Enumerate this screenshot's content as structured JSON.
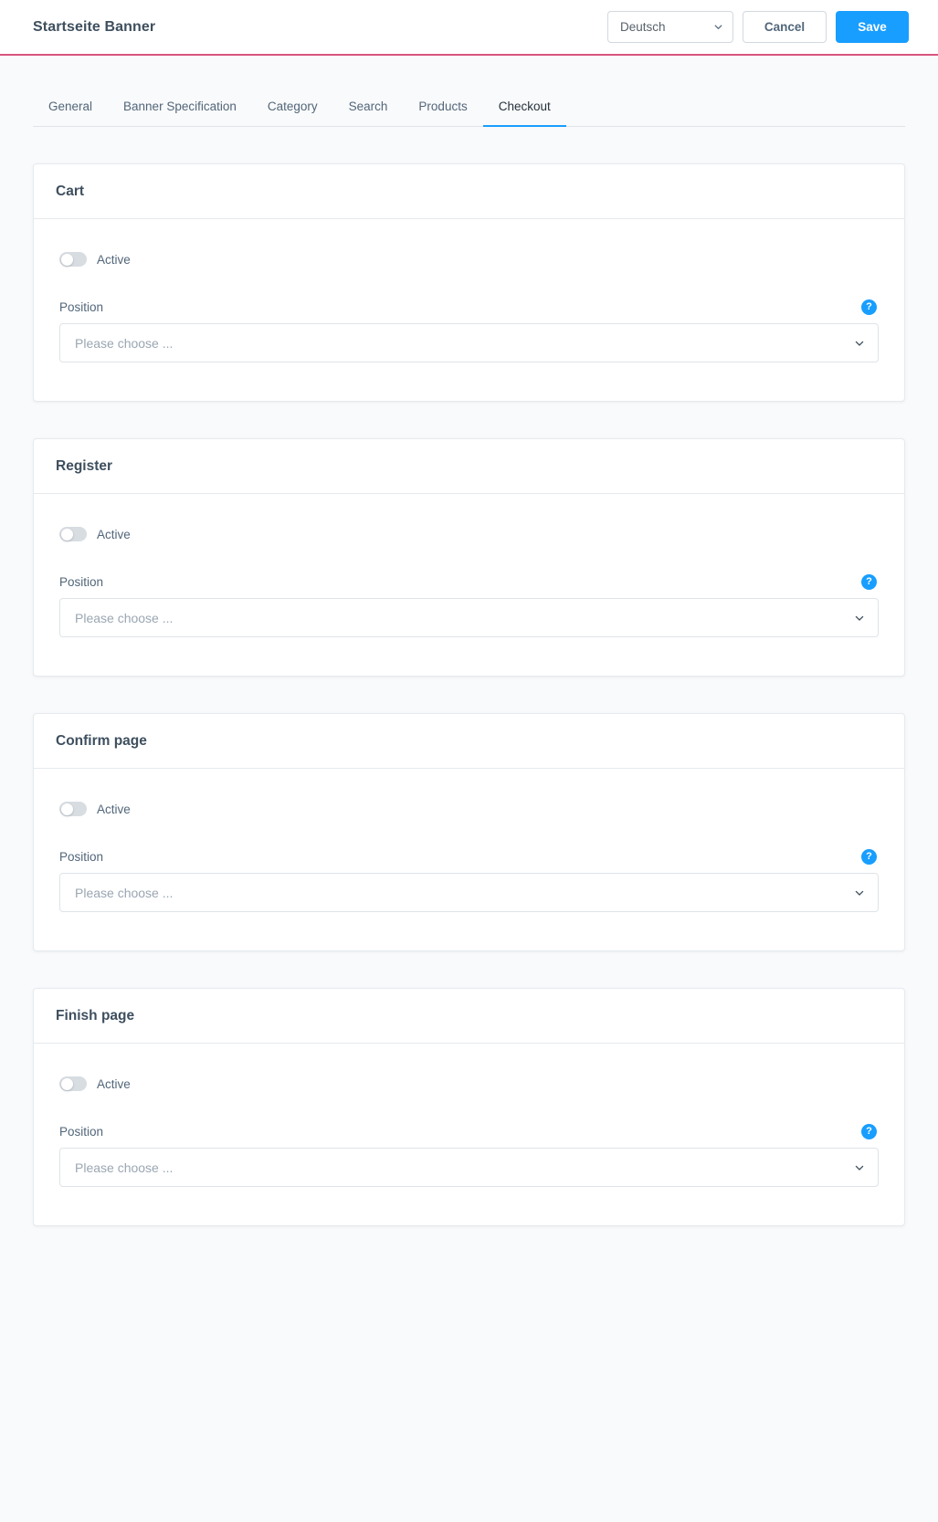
{
  "header": {
    "title": "Startseite Banner",
    "language_select": {
      "value": "Deutsch",
      "chevron": "chevron-down-icon"
    },
    "cancel_label": "Cancel",
    "save_label": "Save",
    "accent_bottom_border": "#d8547f",
    "primary_color": "#189eff"
  },
  "tabs": [
    {
      "label": "General",
      "active": false
    },
    {
      "label": "Banner Specification",
      "active": false
    },
    {
      "label": "Category",
      "active": false
    },
    {
      "label": "Search",
      "active": false
    },
    {
      "label": "Products",
      "active": false
    },
    {
      "label": "Checkout",
      "active": true
    }
  ],
  "common": {
    "switch_label": "Active",
    "position_label": "Position",
    "select_placeholder": "Please choose ...",
    "help_glyph": "?",
    "switch_state": "off"
  },
  "cards": [
    {
      "title": "Cart",
      "switch_label": "Active",
      "switch_state": "off",
      "position_label": "Position",
      "select_value": "Please choose ..."
    },
    {
      "title": "Register",
      "switch_label": "Active",
      "switch_state": "off",
      "position_label": "Position",
      "select_value": "Please choose ..."
    },
    {
      "title": "Confirm page",
      "switch_label": "Active",
      "switch_state": "off",
      "position_label": "Position",
      "select_value": "Please choose ..."
    },
    {
      "title": "Finish page",
      "switch_label": "Active",
      "switch_state": "off",
      "position_label": "Position",
      "select_value": "Please choose ..."
    }
  ]
}
